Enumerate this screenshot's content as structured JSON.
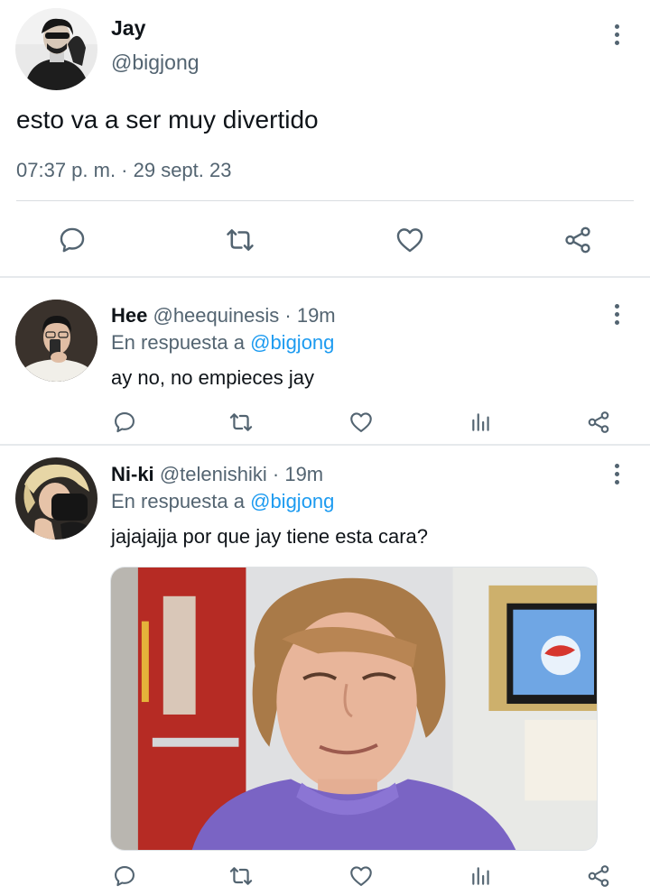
{
  "main_tweet": {
    "name": "Jay",
    "handle": "@bigjong",
    "text": "esto va a ser muy divertido",
    "timestamp": "07:37 p. m. · 29 sept. 23",
    "actions": [
      "reply-icon",
      "retweet-icon",
      "like-icon",
      "share-icon"
    ]
  },
  "replies": [
    {
      "name": "Hee",
      "handle": "@heequinesis",
      "separator": "·",
      "time": "19m",
      "reply_prefix": "En respuesta a",
      "reply_to": "@bigjong",
      "text": "ay no, no empieces jay",
      "actions": [
        "reply-icon",
        "retweet-icon",
        "like-icon",
        "analytics-icon",
        "share-icon"
      ]
    },
    {
      "name": "Ni-ki",
      "handle": "@telenishiki",
      "separator": "·",
      "time": "19m",
      "reply_prefix": "En respuesta a",
      "reply_to": "@bigjong",
      "text": "jajajajja por que jay tiene esta cara?",
      "media": "photo",
      "actions": [
        "reply-icon",
        "retweet-icon",
        "like-icon",
        "analytics-icon",
        "share-icon"
      ]
    }
  ],
  "colors": {
    "text_primary": "#0f1419",
    "text_secondary": "#536471",
    "mention": "#1d9bf0",
    "divider": "#e6e9ec"
  }
}
